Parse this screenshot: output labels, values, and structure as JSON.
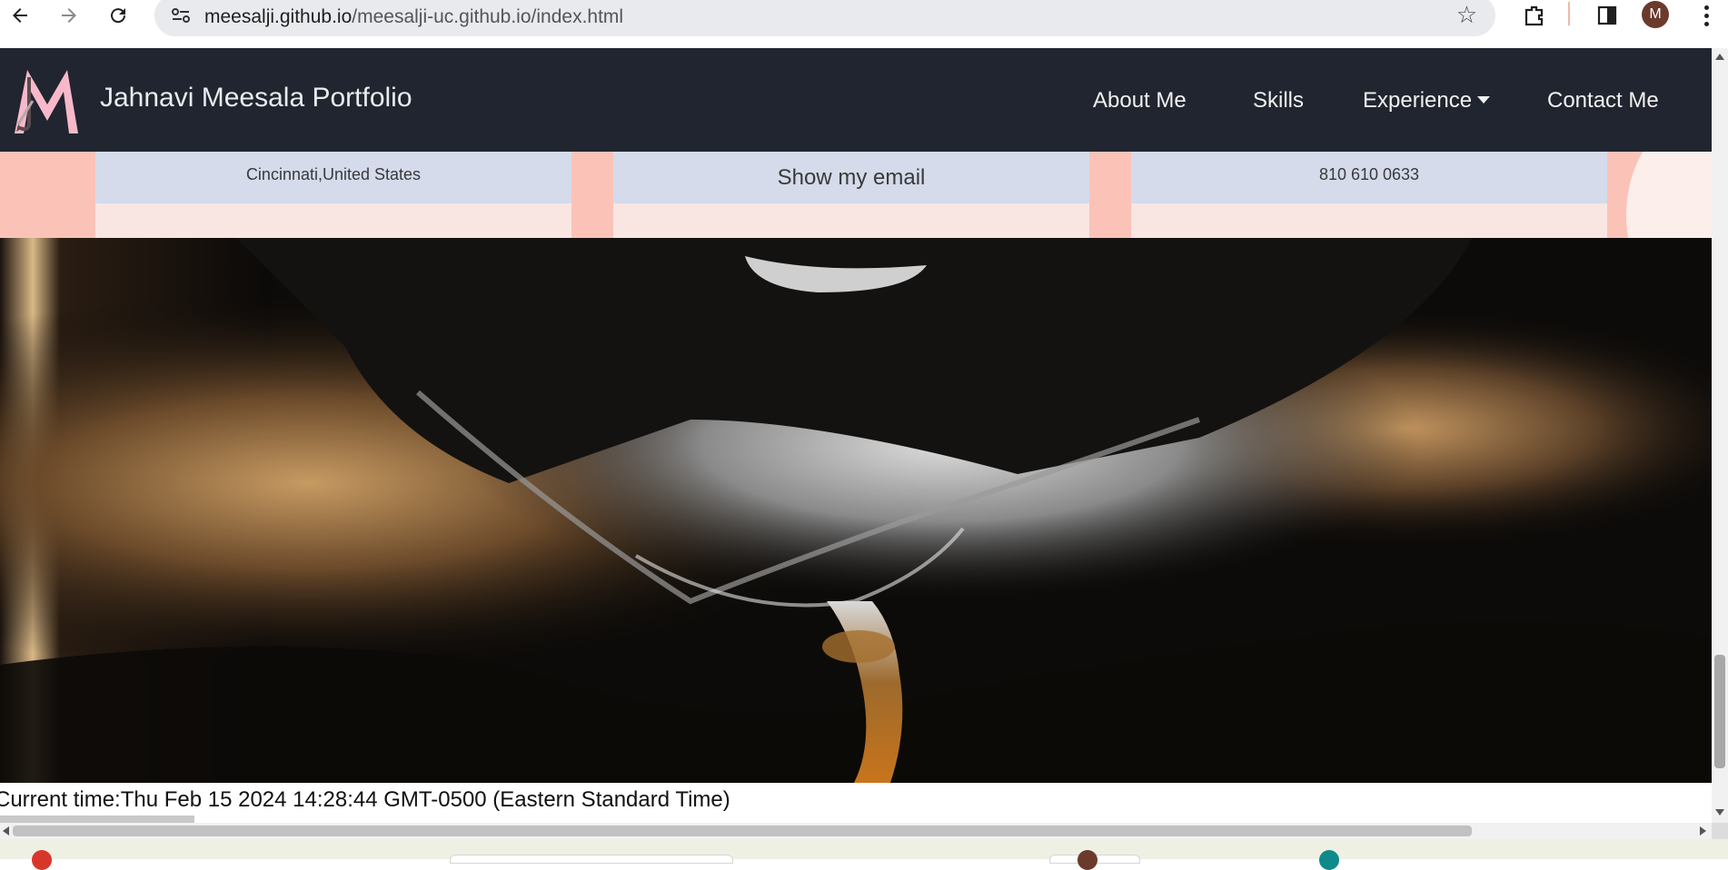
{
  "browser": {
    "url_host": "meesalji.github.io",
    "url_path": "/meesalji-uc.github.io/index.html",
    "avatar_letter": "M",
    "icons": [
      "back-arrow-icon",
      "forward-arrow-icon",
      "reload-icon",
      "site-info-icon",
      "bookmark-star-icon",
      "extensions-icon",
      "side-panel-icon",
      "profile-avatar",
      "menu-kebab-icon"
    ]
  },
  "navbar": {
    "brand": "Jahnavi Meesala Portfolio",
    "links": [
      "About Me",
      "Skills",
      "Experience",
      "Contact Me"
    ],
    "colors": {
      "background": "#21252f",
      "logo_pink": "#f7b9c9"
    }
  },
  "contact": {
    "location": "Cincinnati,United States",
    "email_button": "Show my email",
    "phone": "810 610 0633",
    "colors": {
      "band": "#fbc3b8",
      "card_head": "#d5dbeb",
      "card_body": "#f9e6e3"
    }
  },
  "footer": {
    "current_time": "Current time:Thu Feb 15 2024 14:28:44 GMT-0500 (Eastern Standard Time)"
  }
}
